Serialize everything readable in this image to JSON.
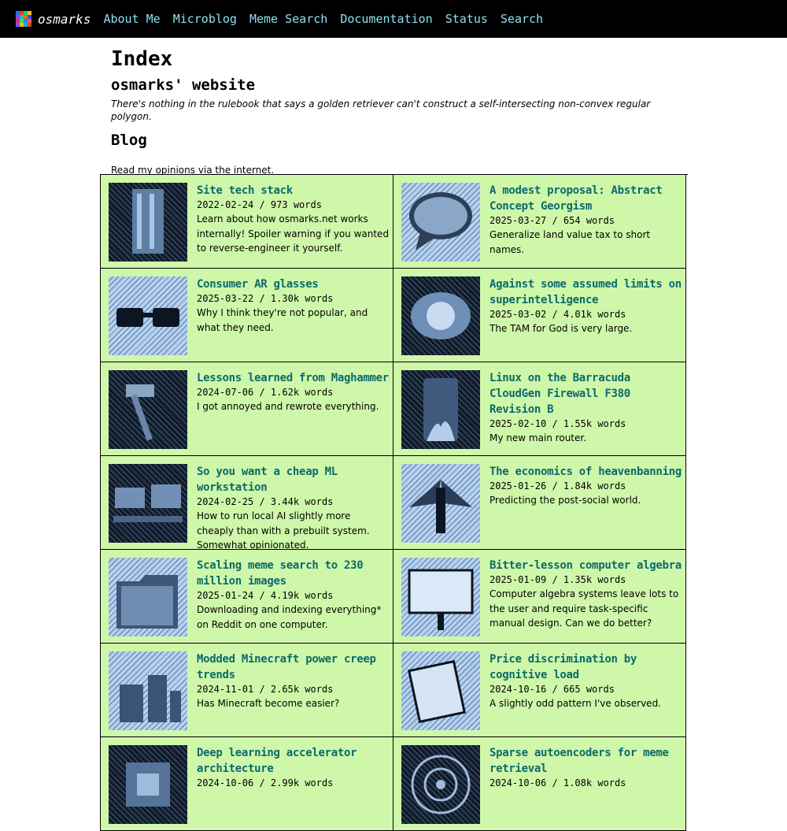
{
  "nav": {
    "brand": "osmarks",
    "logo_colors": [
      "#2b6fd9",
      "#e23c3c",
      "#31c25c",
      "#f2c230",
      "#9a3fd6",
      "#26b7c9",
      "#e86a1f",
      "#3b4ee0",
      "#cf2f8a",
      "#5bd13f",
      "#1c8be0",
      "#f05a5a",
      "#7d4fe0",
      "#e0c127",
      "#2fa8a0",
      "#d64a1f"
    ],
    "links": [
      "About Me",
      "Microblog",
      "Meme Search",
      "Documentation",
      "Status",
      "Search"
    ]
  },
  "page": {
    "title": "Index",
    "subtitle": "osmarks' website",
    "tagline": "There's nothing in the rulebook that says a golden retriever can't construct a self-intersecting non-convex regular polygon.",
    "section": "Blog",
    "intro": "Read my opinions via the internet."
  },
  "posts": [
    {
      "title": "Site tech stack",
      "meta": "2022-02-24 / 973 words",
      "desc": "Learn about how osmarks.net works internally! Spoiler warning if you wanted to reverse-engineer it yourself.",
      "icon": "skyscraper-thumbnail",
      "tone": "dark"
    },
    {
      "title": "A modest proposal: Abstract Concept Georgism",
      "meta": "2025-03-27 / 654 words",
      "desc": "Generalize land value tax to short names.",
      "icon": "speech-bubble-thumbnail",
      "tone": "light"
    },
    {
      "title": "Consumer AR glasses",
      "meta": "2025-03-22 / 1.30k words",
      "desc": "Why I think they're not popular, and what they need.",
      "icon": "glasses-thumbnail",
      "tone": "light"
    },
    {
      "title": "Against some assumed limits on superintelligence",
      "meta": "2025-03-02 / 4.01k words",
      "desc": "The TAM for God is very large.",
      "icon": "galaxy-thumbnail",
      "tone": "dark"
    },
    {
      "title": "Lessons learned from Maghammer",
      "meta": "2024-07-06 / 1.62k words",
      "desc": "I got annoyed and rewrote everything.",
      "icon": "hammer-thumbnail",
      "tone": "dark"
    },
    {
      "title": "Linux on the Barracuda CloudGen Firewall F380 Revision B",
      "meta": "2025-02-10 / 1.55k words",
      "desc": "My new main router.",
      "icon": "firewall-thumbnail",
      "tone": "dark"
    },
    {
      "title": "So you want a cheap ML workstation",
      "meta": "2024-02-25 / 3.44k words",
      "desc": "How to run local AI slightly more cheaply than with a prebuilt system. Somewhat opinionated.",
      "icon": "workstation-thumbnail",
      "tone": "dark"
    },
    {
      "title": "The economics of heavenbanning",
      "meta": "2025-01-26 / 1.84k words",
      "desc": "Predicting the post-social world.",
      "icon": "angel-thumbnail",
      "tone": "light"
    },
    {
      "title": "Scaling meme search to 230 million images",
      "meta": "2025-01-24 / 4.19k words",
      "desc": "Downloading and indexing everything* on Reddit on one computer.",
      "icon": "folder-thumbnail",
      "tone": "light"
    },
    {
      "title": "Bitter-lesson computer algebra",
      "meta": "2025-01-09 / 1.35k words",
      "desc": "Computer algebra systems leave lots to the user and require task-specific manual design. Can we do better?",
      "icon": "whiteboard-thumbnail",
      "tone": "light"
    },
    {
      "title": "Modded Minecraft power creep trends",
      "meta": "2024-11-01 / 2.65k words",
      "desc": "Has Minecraft become easier?",
      "icon": "factory-thumbnail",
      "tone": "light"
    },
    {
      "title": "Price discrimination by cognitive load",
      "meta": "2024-10-16 / 665 words",
      "desc": "A slightly odd pattern I've observed.",
      "icon": "money-thumbnail",
      "tone": "light"
    },
    {
      "title": "Deep learning accelerator architecture",
      "meta": "2024-10-06 / 2.99k words",
      "desc": "",
      "icon": "chip-thumbnail",
      "tone": "dark"
    },
    {
      "title": "Sparse autoencoders for meme retrieval",
      "meta": "2024-10-06 / 1.08k words",
      "desc": "",
      "icon": "network-thumbnail",
      "tone": "dark"
    }
  ]
}
